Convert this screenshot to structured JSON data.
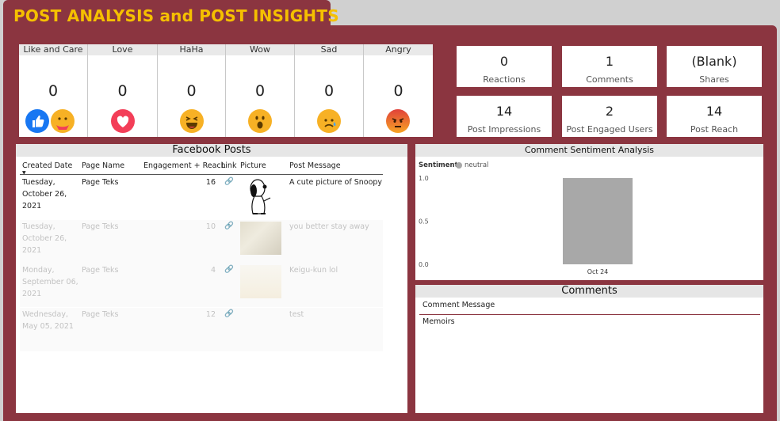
{
  "header": {
    "title": "POST ANALYSIS and POST INSIGHTS"
  },
  "reactions": [
    {
      "label": "Like and Care",
      "value": "0",
      "icon": "like-care-icon"
    },
    {
      "label": "Love",
      "value": "0",
      "icon": "love-icon"
    },
    {
      "label": "HaHa",
      "value": "0",
      "icon": "haha-icon"
    },
    {
      "label": "Wow",
      "value": "0",
      "icon": "wow-icon"
    },
    {
      "label": "Sad",
      "value": "0",
      "icon": "sad-icon"
    },
    {
      "label": "Angry",
      "value": "0",
      "icon": "angry-icon"
    }
  ],
  "kpis": [
    {
      "value": "0",
      "label": "Reactions"
    },
    {
      "value": "1",
      "label": "Comments"
    },
    {
      "value": "(Blank)",
      "label": "Shares"
    },
    {
      "value": "14",
      "label": "Post Impressions"
    },
    {
      "value": "2",
      "label": "Post Engaged Users"
    },
    {
      "value": "14",
      "label": "Post Reach"
    }
  ],
  "posts": {
    "title": "Facebook Posts",
    "columns": [
      "Created Date",
      "Page Name",
      "Engagement + Reach",
      "Link",
      "Picture",
      "Post Message"
    ],
    "rows": [
      {
        "date": [
          "Tuesday,",
          "October 26,",
          "2021"
        ],
        "page": "Page Teks",
        "engagement": "16",
        "message": "A cute picture of Snoopy",
        "picture": "snoopy"
      },
      {
        "date": [
          "Tuesday,",
          "October 26,",
          "2021"
        ],
        "page": "Page Teks",
        "engagement": "10",
        "message": "you better stay away",
        "picture": "photo"
      },
      {
        "date": [
          "Monday,",
          "September 06,",
          "2021"
        ],
        "page": "Page Teks",
        "engagement": "4",
        "message": "Keigu-kun lol",
        "picture": "meme"
      },
      {
        "date": [
          "Wednesday,",
          "May 05, 2021"
        ],
        "page": "Page Teks",
        "engagement": "12",
        "message": "test",
        "picture": "none"
      }
    ]
  },
  "sentiment": {
    "title": "Comment Sentiment Analysis",
    "legend_title": "Sentiment",
    "colors": {
      "neutral": "#a8a8a8",
      "accent": "#8b3540",
      "title": "#f5c000"
    }
  },
  "chart_data": {
    "type": "bar",
    "categories": [
      "Oct 24"
    ],
    "series": [
      {
        "name": "neutral",
        "values": [
          1.0
        ]
      }
    ],
    "yticks": [
      "1.0",
      "0.5",
      "0.0"
    ],
    "ylim": [
      0,
      1.0
    ],
    "legend": "top-left",
    "grid": false
  },
  "comments": {
    "title": "Comments",
    "column": "Comment Message",
    "rows": [
      "Memoirs"
    ]
  }
}
